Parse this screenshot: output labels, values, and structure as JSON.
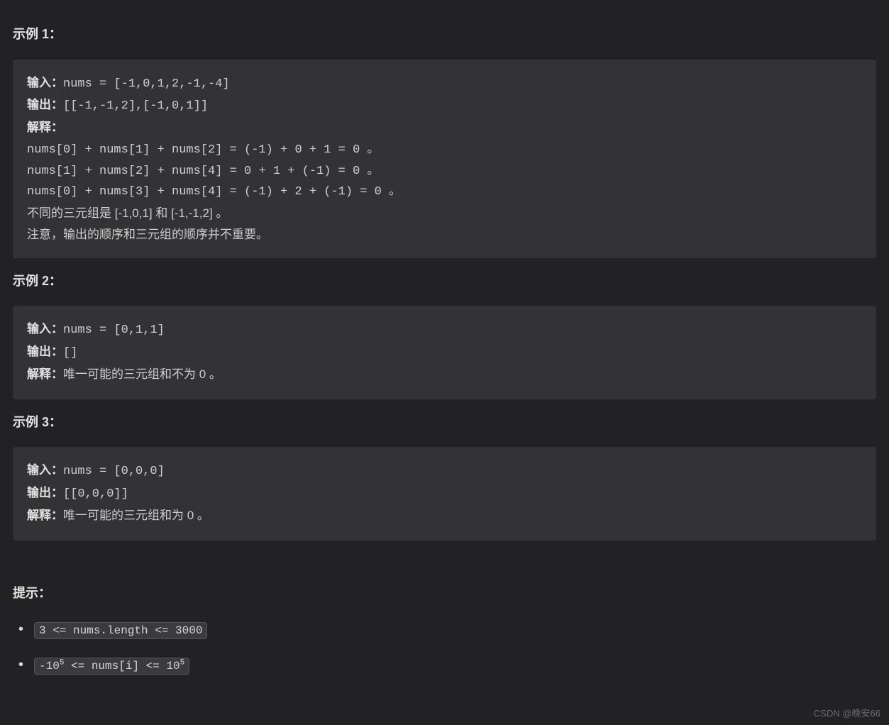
{
  "headings": {
    "ex1": "示例 1：",
    "ex2": "示例 2：",
    "ex3": "示例 3：",
    "hints": "提示："
  },
  "labels": {
    "input": "输入：",
    "output": "输出：",
    "explain": "解释："
  },
  "ex1": {
    "input": "nums = [-1,0,1,2,-1,-4]",
    "output": "[[-1,-1,2],[-1,0,1]]",
    "lines": [
      "nums[0] + nums[1] + nums[2] = (-1) + 0 + 1 = 0 。",
      "nums[1] + nums[2] + nums[4] = 0 + 1 + (-1) = 0 。",
      "nums[0] + nums[3] + nums[4] = (-1) + 2 + (-1) = 0 。"
    ],
    "plain": [
      "不同的三元组是 [-1,0,1] 和 [-1,-1,2] 。",
      "注意，输出的顺序和三元组的顺序并不重要。"
    ]
  },
  "ex2": {
    "input": "nums = [0,1,1]",
    "output": "[]",
    "explain": "唯一可能的三元组和不为 0 。"
  },
  "ex3": {
    "input": "nums = [0,0,0]",
    "output": "[[0,0,0]]",
    "explain": "唯一可能的三元组和为 0 。"
  },
  "hints": {
    "h1": "3 <= nums.length <= 3000",
    "h2_pre": "-10",
    "h2_sup1": "5",
    "h2_mid": " <= nums[i] <= 10",
    "h2_sup2": "5"
  },
  "watermark": "CSDN @晚安66"
}
